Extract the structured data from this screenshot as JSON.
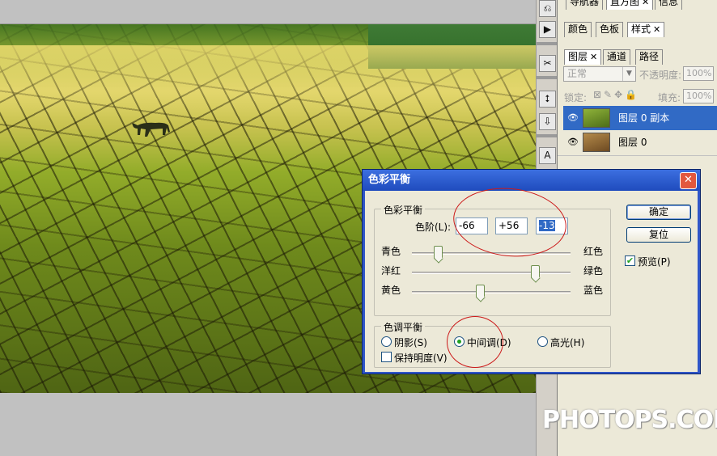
{
  "right_panel": {
    "tabs_row1": [
      "导航器",
      "直方图",
      "信息"
    ],
    "tabs_row2": [
      "颜色",
      "色板",
      "样式"
    ],
    "tabs_row3": [
      "图层",
      "通道",
      "路径"
    ],
    "blend_mode": "正常",
    "opacity_label": "不透明度:",
    "opacity_value": "100%",
    "lock_label": "锁定:",
    "fill_label": "填充:",
    "fill_value": "100%",
    "layers": [
      {
        "name": "图层 0 副本",
        "selected": true
      },
      {
        "name": "图层 0",
        "selected": false
      }
    ]
  },
  "toolbar": {
    "icons": [
      "history-icon",
      "action-icon",
      "brush-tool-icon",
      "usb-icon",
      "save-icon",
      "type-tool-icon"
    ],
    "glyphs": [
      "⎌",
      "▶",
      "✂",
      "⭥",
      "⇩",
      "A"
    ]
  },
  "dialog": {
    "title": "色彩平衡",
    "close": "✕",
    "group1_label": "色彩平衡",
    "levels_label": "色阶(L):",
    "levels": [
      "-66",
      "+56",
      "-13"
    ],
    "sliders": [
      {
        "left": "青色",
        "right": "红色",
        "value": -66
      },
      {
        "left": "洋红",
        "right": "绿色",
        "value": 56
      },
      {
        "left": "黄色",
        "right": "蓝色",
        "value": -13
      }
    ],
    "group2_label": "色调平衡",
    "tone_options": [
      "阴影(S)",
      "中间调(D)",
      "高光(H)"
    ],
    "tone_selected": "中间调(D)",
    "preserve_label": "保持明度(V)",
    "preserve_checked": false,
    "ok_label": "确定",
    "reset_label": "复位",
    "preview_label": "预览(P)",
    "preview_checked": true
  },
  "watermark": "PHOTOPS.COM",
  "colors": {
    "selection": "#316ac5",
    "annotation_ring": "#cc1a1a",
    "title_bar": "#2f55c8"
  }
}
